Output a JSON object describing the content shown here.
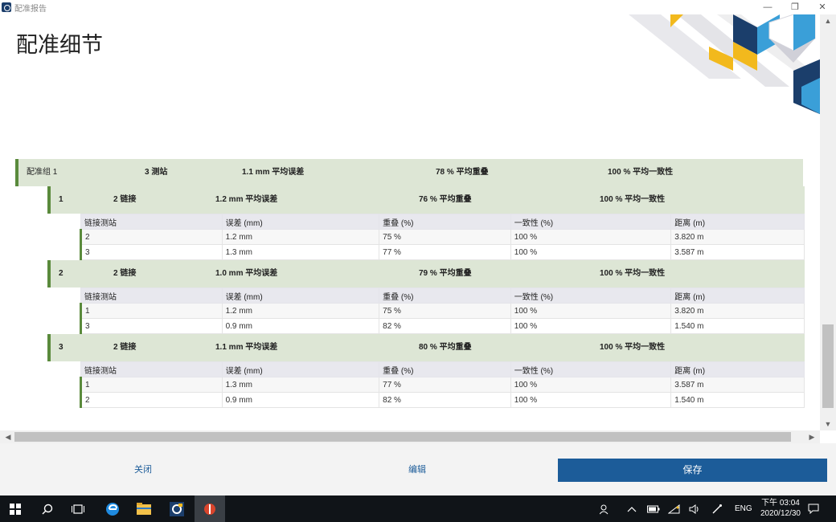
{
  "window": {
    "title": "配准报告",
    "minimize": "—",
    "restore": "❐",
    "close": "✕"
  },
  "page_title": "配准细节",
  "group": {
    "name": "配准组 1",
    "stations": "3 测站",
    "error": "1.1 mm 平均误差",
    "overlap": "78 % 平均重叠",
    "consistency": "100 % 平均一致性"
  },
  "columns": [
    "链接测站",
    "误差 (mm)",
    "重叠 (%)",
    "一致性 (%)",
    "距离 (m)"
  ],
  "stations": [
    {
      "id": "1",
      "links": "2 链接",
      "error": "1.2 mm 平均误差",
      "overlap": "76 % 平均重叠",
      "consistency": "100 % 平均一致性",
      "rows": [
        [
          "2",
          "1.2 mm",
          "75 %",
          "100 %",
          "3.820 m"
        ],
        [
          "3",
          "1.3 mm",
          "77 %",
          "100 %",
          "3.587 m"
        ]
      ]
    },
    {
      "id": "2",
      "links": "2 链接",
      "error": "1.0 mm 平均误差",
      "overlap": "79 % 平均重叠",
      "consistency": "100 % 平均一致性",
      "rows": [
        [
          "1",
          "1.2 mm",
          "75 %",
          "100 %",
          "3.820 m"
        ],
        [
          "3",
          "0.9 mm",
          "82 %",
          "100 %",
          "1.540 m"
        ]
      ]
    },
    {
      "id": "3",
      "links": "2 链接",
      "error": "1.1 mm 平均误差",
      "overlap": "80 % 平均重叠",
      "consistency": "100 % 平均一致性",
      "rows": [
        [
          "1",
          "1.3 mm",
          "77 %",
          "100 %",
          "3.587 m"
        ],
        [
          "2",
          "0.9 mm",
          "82 %",
          "100 %",
          "1.540 m"
        ]
      ]
    }
  ],
  "footer": {
    "close": "关闭",
    "edit": "编辑",
    "save": "保存"
  },
  "taskbar": {
    "lang": "ENG",
    "time": "下午 03:04",
    "date": "2020/12/30"
  },
  "colors": {
    "accent": "#1c5c99",
    "group_bg": "#dde6d5",
    "group_bar": "#5a8a3c"
  }
}
